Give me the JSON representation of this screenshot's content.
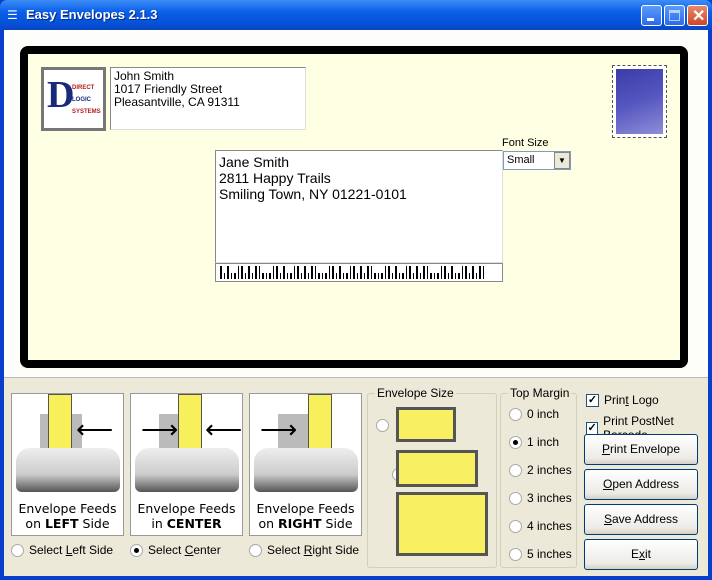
{
  "window": {
    "title": "Easy Envelopes 2.1.3"
  },
  "return_address": {
    "lines": [
      "John Smith",
      "1017 Friendly Street",
      "Pleasantville, CA 91311"
    ]
  },
  "logo": {
    "text": "DIRECT LOGIC SYSTEMS"
  },
  "font_size": {
    "label": "Font Size",
    "value": "Small"
  },
  "recipient": {
    "lines": [
      "Jane Smith",
      "2811 Happy Trails",
      "Smiling Town, NY 01221-0101"
    ]
  },
  "feeds": [
    {
      "line1": "Envelope Feeds",
      "pre": "on ",
      "bold": "LEFT",
      "post": " Side",
      "radio_pre": "Select ",
      "radio_u": "L",
      "radio_post": "eft Side",
      "selected": false
    },
    {
      "line1": "Envelope Feeds",
      "pre": "in ",
      "bold": "CENTER",
      "post": "",
      "radio_pre": "Select ",
      "radio_u": "C",
      "radio_post": "enter",
      "selected": true
    },
    {
      "line1": "Envelope Feeds",
      "pre": "on ",
      "bold": "RIGHT",
      "post": " Side",
      "radio_pre": "Select ",
      "radio_u": "R",
      "radio_post": "ight Side",
      "selected": false
    }
  ],
  "envelope_size": {
    "label": "Envelope Size",
    "selected_index": 1
  },
  "top_margin": {
    "label": "Top Margin",
    "options": [
      "0 inch",
      "1 inch",
      "2 inches",
      "3 inches",
      "4 inches",
      "5 inches"
    ],
    "selected_index": 1
  },
  "checkboxes": {
    "print_logo": {
      "pre": "Prin",
      "u": "t",
      "post": " Logo",
      "checked": true
    },
    "print_barcode": {
      "pre": "Print PostNet ",
      "u": "B",
      "post": "arcode",
      "checked": true
    }
  },
  "buttons": [
    {
      "u": "P",
      "rest": "rint Envelope",
      "name": "print-envelope-button"
    },
    {
      "u": "O",
      "rest": "pen Address",
      "name": "open-address-button"
    },
    {
      "u": "S",
      "rest": "ave Address",
      "name": "save-address-button"
    },
    {
      "pre": "E",
      "u": "x",
      "rest": "it",
      "name": "exit-button"
    }
  ]
}
